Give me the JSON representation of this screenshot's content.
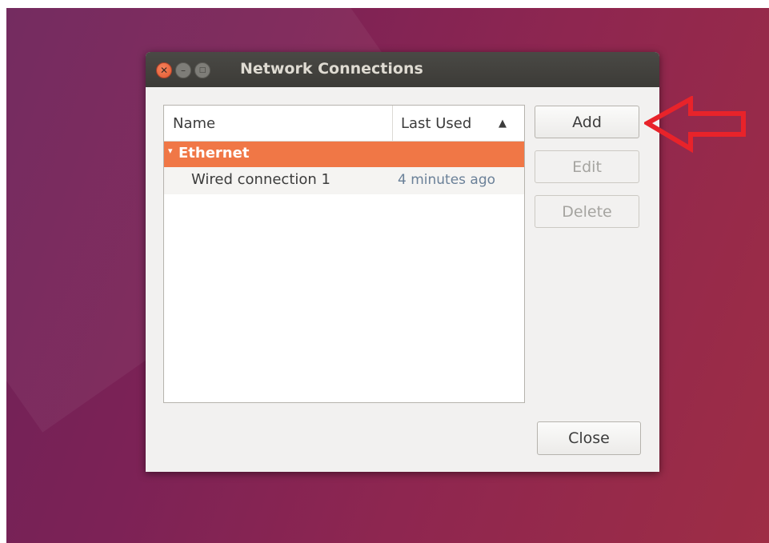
{
  "window": {
    "title": "Network Connections",
    "controls": {
      "close_glyph": "✕",
      "minimize_glyph": "–",
      "maximize_glyph": "□"
    }
  },
  "list": {
    "columns": [
      "Name",
      "Last Used"
    ],
    "sort_indicator": "▲",
    "groups": [
      {
        "label": "Ethernet",
        "expander": "▾",
        "items": [
          {
            "name": "Wired connection 1",
            "last_used": "4 minutes ago"
          }
        ]
      }
    ]
  },
  "buttons": {
    "add": "Add",
    "edit": "Edit",
    "delete": "Delete",
    "close": "Close"
  },
  "colors": {
    "selection": "#f07746",
    "annotation_arrow": "#e8232a"
  }
}
